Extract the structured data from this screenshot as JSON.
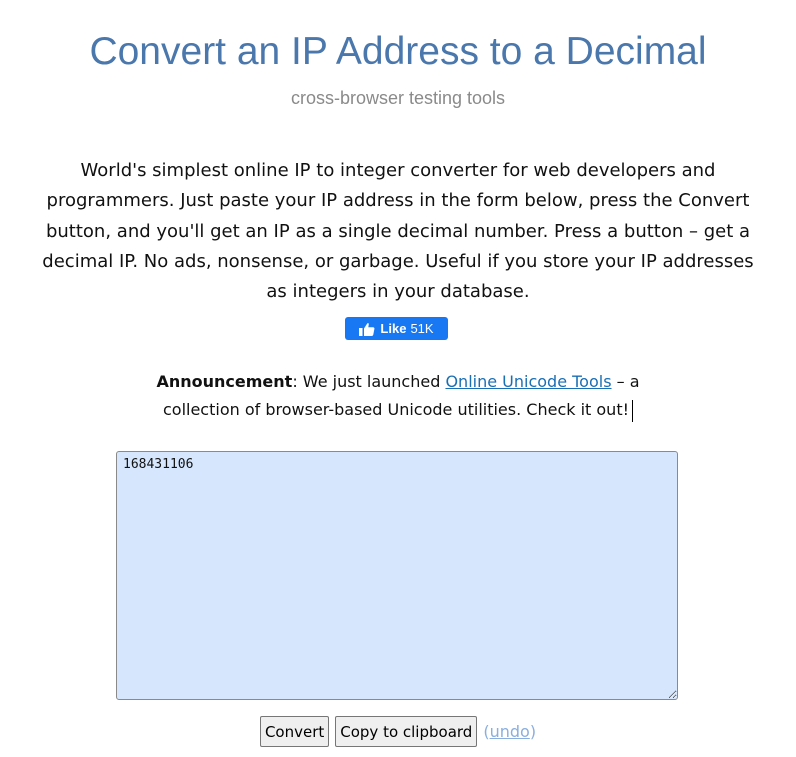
{
  "header": {
    "title": "Convert an IP Address to a Decimal",
    "subtitle": "cross-browser testing tools"
  },
  "description": "World's simplest online IP to integer converter for web developers and programmers. Just paste your IP address in the form below, press the Convert button, and you'll get an IP as a single decimal number. Press a button – get a decimal IP. No ads, nonsense, or garbage. Useful if you store your IP addresses as integers in your database.",
  "like_button": {
    "label": "Like",
    "count": "51K",
    "icon": "thumbs-up-icon",
    "color": "#1877f2"
  },
  "announcement": {
    "label": "Announcement",
    "text_before": ": We just launched ",
    "link_text": "Online Unicode Tools",
    "text_after": " – a collection of browser-based Unicode utilities. Check it out!"
  },
  "output": {
    "value": "168431106",
    "background": "#d5e6fd"
  },
  "controls": {
    "convert_label": "Convert",
    "copy_label": "Copy to clipboard",
    "undo_open": "(",
    "undo_label": "undo",
    "undo_close": ")"
  },
  "colors": {
    "title": "#4a77ac",
    "link": "#1a6fb4",
    "undo": "#8aaede"
  }
}
